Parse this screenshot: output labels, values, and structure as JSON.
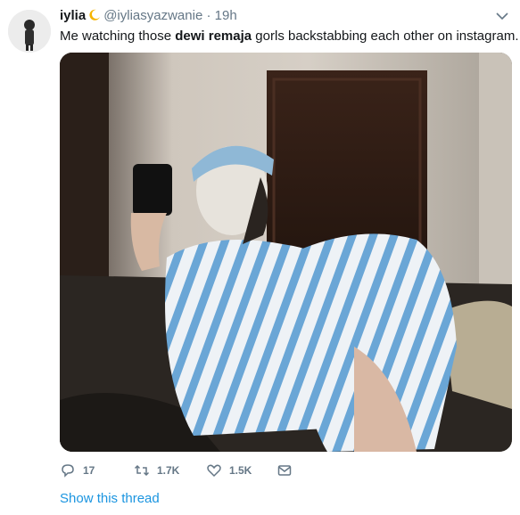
{
  "tweet": {
    "display_name": "iylia",
    "handle": "@iyliasyazwanie",
    "separator": "·",
    "time": "19h",
    "text_before": "Me watching those ",
    "text_bold": "dewi remaja",
    "text_after": " gorls backstabbing each other on instagram."
  },
  "actions": {
    "reply_count": "17",
    "retweet_count": "1.7K",
    "like_count": "1.5K"
  },
  "thread_link": "Show this thread",
  "icons": [
    "chevron-down-icon",
    "moon-emoji-icon",
    "reply-icon",
    "retweet-icon",
    "like-icon",
    "message-icon"
  ],
  "colors": {
    "link": "#1b95e0",
    "muted": "#657786",
    "text": "#14171a"
  }
}
